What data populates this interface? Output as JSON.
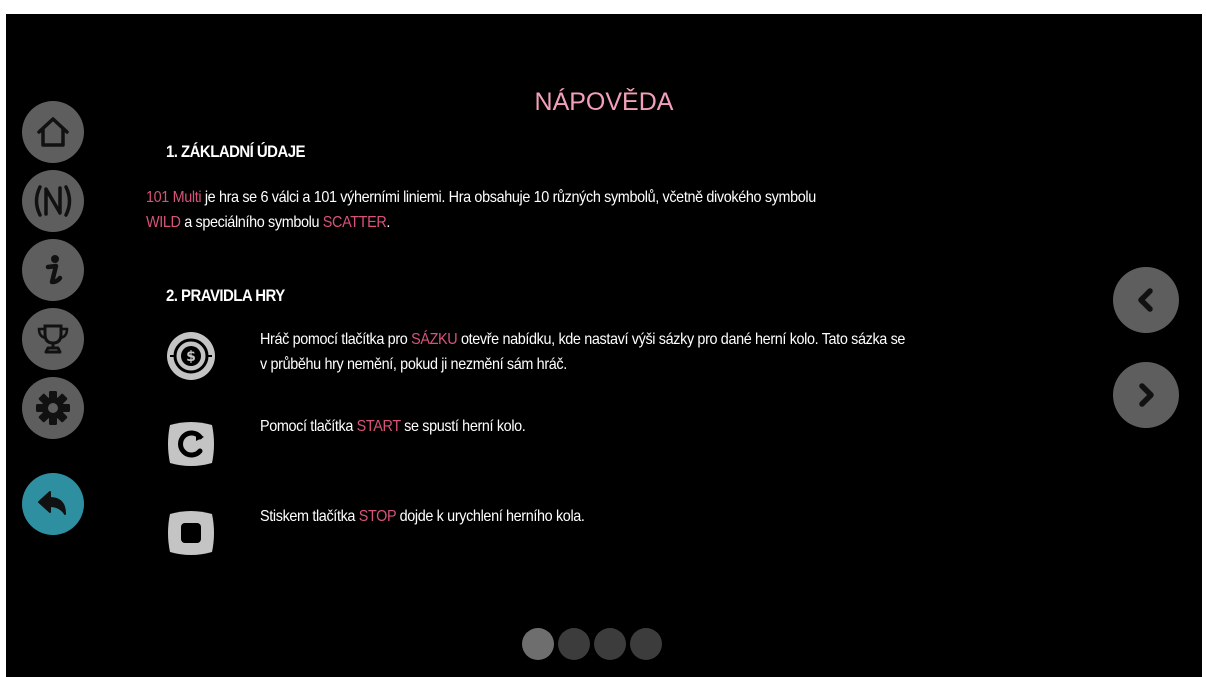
{
  "page": {
    "title": "NÁPOVĚDA"
  },
  "sidebar": {
    "items": [
      {
        "name": "home",
        "icon": "home-icon"
      },
      {
        "name": "paylines",
        "icon": "paylines-icon"
      },
      {
        "name": "info",
        "icon": "info-icon"
      },
      {
        "name": "trophy",
        "icon": "trophy-icon"
      },
      {
        "name": "settings",
        "icon": "gear-icon"
      },
      {
        "name": "back",
        "icon": "back-arrow-icon"
      }
    ],
    "back_color": "#2e8fa0"
  },
  "section1": {
    "heading": "1. ZÁKLADNÍ ÚDAJE",
    "line1_game": "101 Multi",
    "line1_text": " je hra se 6 válci a 101 výherními liniemi. Hra obsahuje 10 různých symbolů, včetně divokého symbolu",
    "line2_wild": "WILD",
    "line2_mid": " a speciálního symbolu ",
    "line2_scatter": "SCATTER",
    "line2_end": "."
  },
  "section2": {
    "heading": "2. PRAVIDLA HRY",
    "rules": [
      {
        "icon": "bet-coin-icon",
        "pre": "Hráč pomocí tlačítka pro ",
        "hl": "SÁZKU",
        "post": " otevře nabídku, kde nastaví výši sázky pro dané herní kolo. Tato sázka se",
        "line2": "v průběhu hry nemění, pokud ji nezmění sám hráč."
      },
      {
        "icon": "start-icon",
        "pre": "Pomocí tlačítka ",
        "hl": "START",
        "post": " se spustí herní kolo."
      },
      {
        "icon": "stop-icon",
        "pre": "Stiskem tlačítka ",
        "hl": "STOP",
        "post": " dojde k urychlení herního kola."
      }
    ]
  },
  "pagination": {
    "pages": 4,
    "current": 1
  },
  "colors": {
    "highlight": "#d8537a",
    "title": "#f2a0b8",
    "button": "#5e5e5e"
  }
}
